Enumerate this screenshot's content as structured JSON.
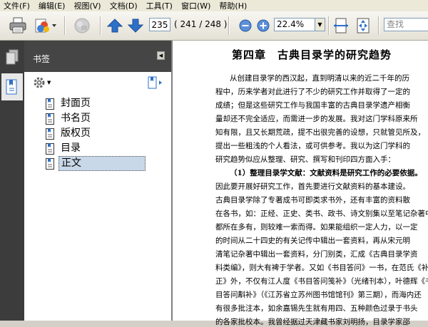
{
  "menu": [
    "文件(F)",
    "编辑(E)",
    "视图(V)",
    "文档(D)",
    "工具(T)",
    "窗口(W)",
    "帮助(H)"
  ],
  "toolbar": {
    "current_page": "235",
    "page_count": "( 241 / 248 )",
    "zoom": "22.4%",
    "search_placeholder": "查找"
  },
  "panel": {
    "title": "书签",
    "bookmarks": [
      {
        "label": "封面页",
        "selected": false
      },
      {
        "label": "书名页",
        "selected": false
      },
      {
        "label": "版权页",
        "selected": false
      },
      {
        "label": "目录",
        "selected": false
      },
      {
        "label": "正文",
        "selected": true
      }
    ]
  },
  "document": {
    "chapter_title": "第四章　古典目录学的研究趋势",
    "lines": [
      "从创建目录学的西汉起，直到明清以来的近二千年的历",
      "程中，历来学者对此进行了不少的研究工作并取得了一定的",
      "成绩；但是这些研究工作与我国丰富的古典目录学遗产相衡",
      "量却还不完全适应，而需进一步的发展。我对这门学科原来所",
      "知有限，且又长期荒疏，提不出很完善的设想，只就管见所及，",
      "提出一些粗浅的个人看法，或可供参考。我以为这门学科的",
      "研究趋势似应从整理、研究、撰写和刊印四方面入手：",
      "（1）整理目录学文献：文献资料是研究工作的必要依据。",
      "因此要开展好研究工作，首先要进行文献资料的基本建设。",
      "古典目录学除了专著成书可即类求书外，还有丰富的资料散",
      "在各书，如：正经、正史、类书、政书、诗文别集以至笔记杂著中",
      "都所在多有，则较难一索而得。如果能组织一定人力，以一定",
      "的时间从二十四史的有关记传中辑出一套资料，再从宋元明",
      "清笔记杂著中辑出一套资料，分门别类，汇成《古典目录学资",
      "料类编》，则大有裨于学者。又如《书目答问》一书，在范氏《补",
      "正》外，不仅有江人度《书目答问笺补》（光绪刊本），叶德辉《书",
      "目答问斠补》（《江苏省立苏州图书馆馆刊》第三期），而海内还",
      "有很多批注本，如余嘉锡先生就有用四、五种颜色过录于书头",
      "的各家批校本。我曾经据过天津藏书家刘明扬，目录学家邵"
    ]
  },
  "colors": {
    "toolbar_bg": "#ece9d8",
    "panel_header_bg": "#454545",
    "nav_strip_bg": "#3c3c3c",
    "selection_bg": "#c8d8e8",
    "icon_blue": "#2e6fc7"
  }
}
